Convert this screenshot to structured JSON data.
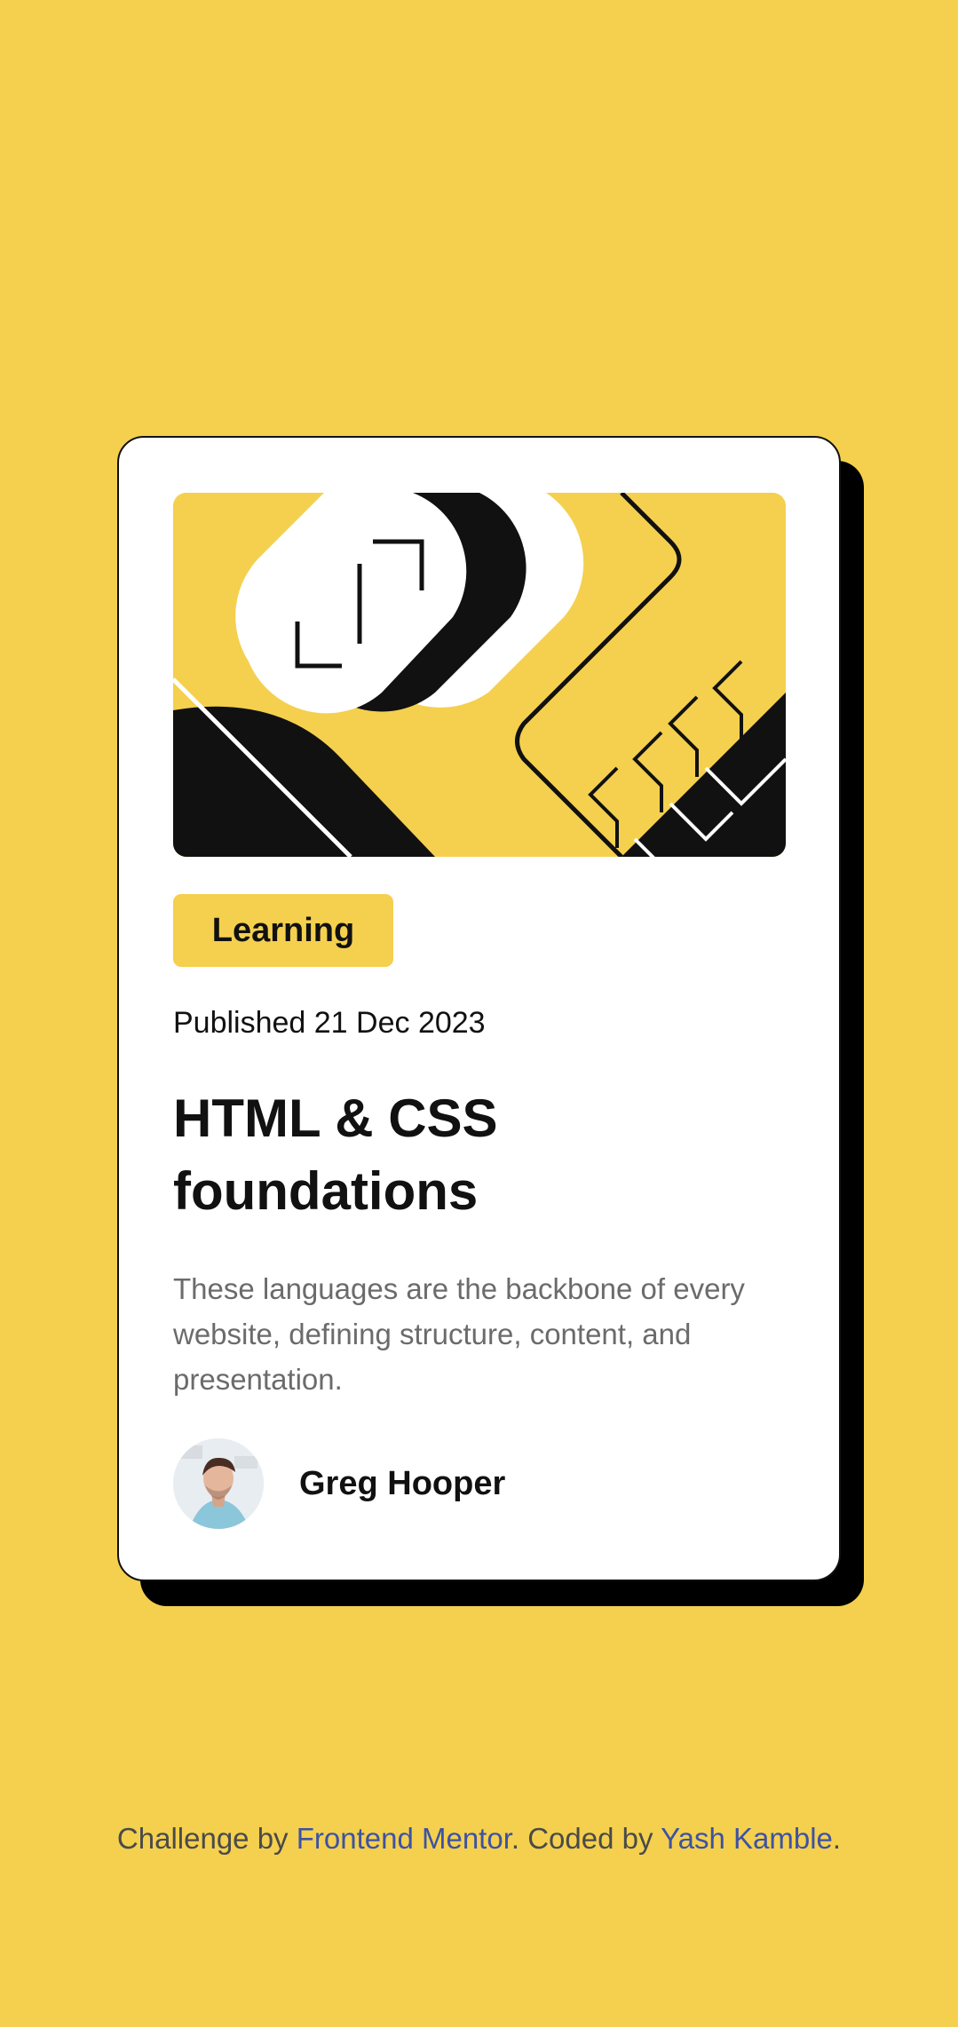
{
  "colors": {
    "background": "#F4D04E",
    "card": "#FFFFFF",
    "shadow": "#000000",
    "text": "#111111",
    "muted_text": "#6B6B6B",
    "link": "#3E52A3"
  },
  "card": {
    "hero_image": "hero-illustration-icon",
    "tag": "Learning",
    "published": "Published 21 Dec 2023",
    "title": "HTML & CSS foundations",
    "description": "These languages are the backbone of every website, defining structure, content, and presentation.",
    "author": {
      "avatar": "avatar-photo-icon",
      "name": "Greg Hooper"
    }
  },
  "attribution": {
    "prefix": "Challenge by ",
    "challenge_link": "Frontend Mentor",
    "middle": ". Coded by ",
    "author_link": "Yash Kamble",
    "suffix": "."
  }
}
